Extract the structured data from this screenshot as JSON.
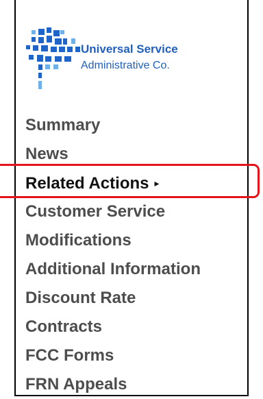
{
  "logo": {
    "line1": "Universal Service",
    "line2": "Administrative Co."
  },
  "nav": {
    "items": [
      {
        "label": "Summary"
      },
      {
        "label": "News"
      },
      {
        "label": "Related Actions",
        "arrow": "▸"
      },
      {
        "label": "Customer Service"
      },
      {
        "label": "Modifications"
      },
      {
        "label": "Additional Information"
      },
      {
        "label": "Discount Rate"
      },
      {
        "label": "Contracts"
      },
      {
        "label": "FCC Forms"
      },
      {
        "label": "FRN Appeals"
      }
    ]
  },
  "colors": {
    "brand_blue": "#1e5fbf",
    "highlight_red": "#e5141a",
    "nav_text": "#4d4d4d"
  }
}
